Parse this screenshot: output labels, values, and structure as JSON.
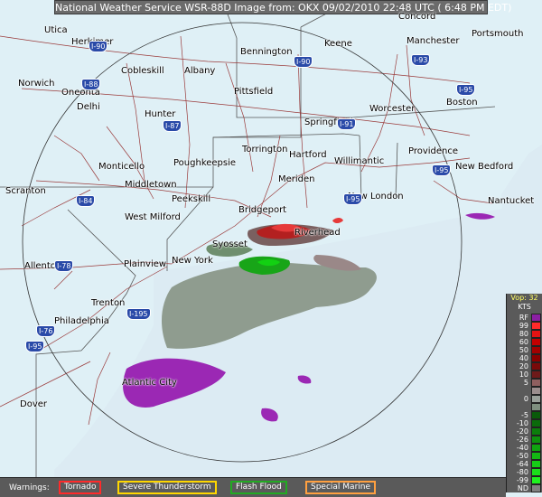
{
  "header": {
    "title": "National Weather Service WSR-88D Image from: OKX 09/02/2010 22:48 UTC ( 6:48 PM EDT)"
  },
  "cities": [
    {
      "name": "Utica"
    },
    {
      "name": "Herkimer"
    },
    {
      "name": "Cobleskill"
    },
    {
      "name": "Albany"
    },
    {
      "name": "Norwich"
    },
    {
      "name": "Oneonta"
    },
    {
      "name": "Delhi"
    },
    {
      "name": "Hunter"
    },
    {
      "name": "Bennington"
    },
    {
      "name": "Keene"
    },
    {
      "name": "Concord"
    },
    {
      "name": "Manchester"
    },
    {
      "name": "Portsmouth"
    },
    {
      "name": "Pittsfield"
    },
    {
      "name": "Worcester"
    },
    {
      "name": "Boston"
    },
    {
      "name": "Springfield"
    },
    {
      "name": "Providence"
    },
    {
      "name": "New Bedford"
    },
    {
      "name": "Torrington"
    },
    {
      "name": "Hartford"
    },
    {
      "name": "Willimantic"
    },
    {
      "name": "Monticello"
    },
    {
      "name": "Poughkeepsie"
    },
    {
      "name": "Meriden"
    },
    {
      "name": "Middletown"
    },
    {
      "name": "Scranton"
    },
    {
      "name": "Peekskill"
    },
    {
      "name": "New London"
    },
    {
      "name": "Nantucket"
    },
    {
      "name": "Bridgeport"
    },
    {
      "name": "West Milford"
    },
    {
      "name": "Riverhead"
    },
    {
      "name": "Syosset"
    },
    {
      "name": "Allentown"
    },
    {
      "name": "Plainview"
    },
    {
      "name": "New York"
    },
    {
      "name": "Trenton"
    },
    {
      "name": "Philadelphia"
    },
    {
      "name": "Atlantic City"
    },
    {
      "name": "Dover"
    }
  ],
  "routes": [
    "I-90",
    "I-90",
    "I-88",
    "I-87",
    "I-91",
    "I-93",
    "I-95",
    "I-95",
    "I-84",
    "I-95",
    "I-78",
    "I-195",
    "I-76",
    "I-95"
  ],
  "legend": {
    "title": "Vop: 32",
    "unit": "KTS",
    "items": [
      {
        "label": "RF",
        "color": "#8c1fa3"
      },
      {
        "label": "99",
        "color": "#ff2a2a"
      },
      {
        "label": "80",
        "color": "#e51313"
      },
      {
        "label": "60",
        "color": "#c40000"
      },
      {
        "label": "50",
        "color": "#a30000"
      },
      {
        "label": "40",
        "color": "#8a0000"
      },
      {
        "label": "20",
        "color": "#7a0a0a"
      },
      {
        "label": "10",
        "color": "#6e1a1a"
      },
      {
        "label": "5",
        "color": "#8f5f5f"
      },
      {
        "label": "",
        "color": "#9b8d8d"
      },
      {
        "label": "0",
        "color": "#9aa09a"
      },
      {
        "label": "",
        "color": "#7f8f7f"
      },
      {
        "label": "-5",
        "color": "#0a5a0a"
      },
      {
        "label": "-10",
        "color": "#0b6b0b"
      },
      {
        "label": "-20",
        "color": "#0c7d0c"
      },
      {
        "label": "-26",
        "color": "#0e900e"
      },
      {
        "label": "-40",
        "color": "#10a410"
      },
      {
        "label": "-50",
        "color": "#13b813"
      },
      {
        "label": "-64",
        "color": "#16cc16"
      },
      {
        "label": "-80",
        "color": "#1ae01a"
      },
      {
        "label": "-99",
        "color": "#1ff21f"
      },
      {
        "label": "ND",
        "color": "#808080"
      }
    ]
  },
  "warnings": {
    "label": "Warnings:",
    "items": [
      {
        "label": "Tornado",
        "color": "#ff2a2a"
      },
      {
        "label": "Severe Thunderstorm",
        "color": "#ffd700"
      },
      {
        "label": "Flash Flood",
        "color": "#22aa22"
      },
      {
        "label": "Special Marine",
        "color": "#ffa040"
      }
    ]
  }
}
